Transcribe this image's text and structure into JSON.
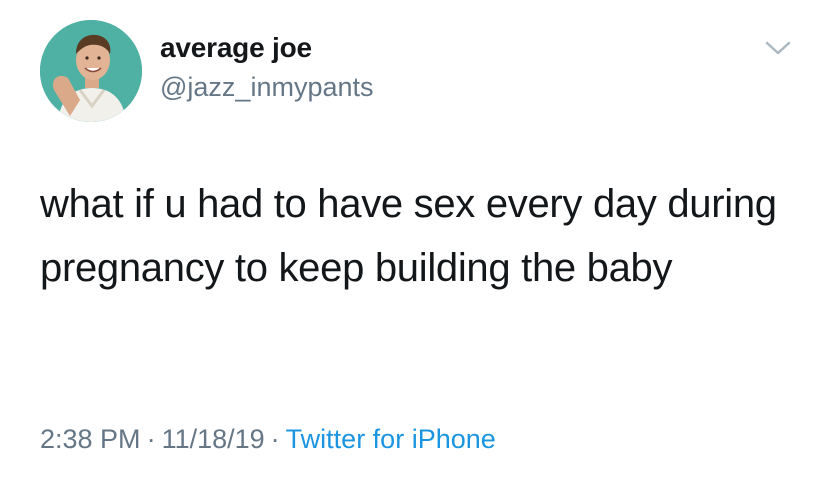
{
  "user": {
    "display_name": "average joe",
    "handle": "@jazz_inmypants"
  },
  "tweet": {
    "text": "what if u had to have sex every day during pregnancy to keep building the baby",
    "time": "2:38 PM",
    "date": "11/18/19",
    "separator": "·",
    "source": "Twitter for iPhone"
  },
  "icons": {
    "menu": "chevron-down-icon"
  },
  "colors": {
    "avatar_background": "#4fb0a4",
    "link": "#1b95e0",
    "secondary_text": "#657786",
    "primary_text": "#14171a"
  }
}
